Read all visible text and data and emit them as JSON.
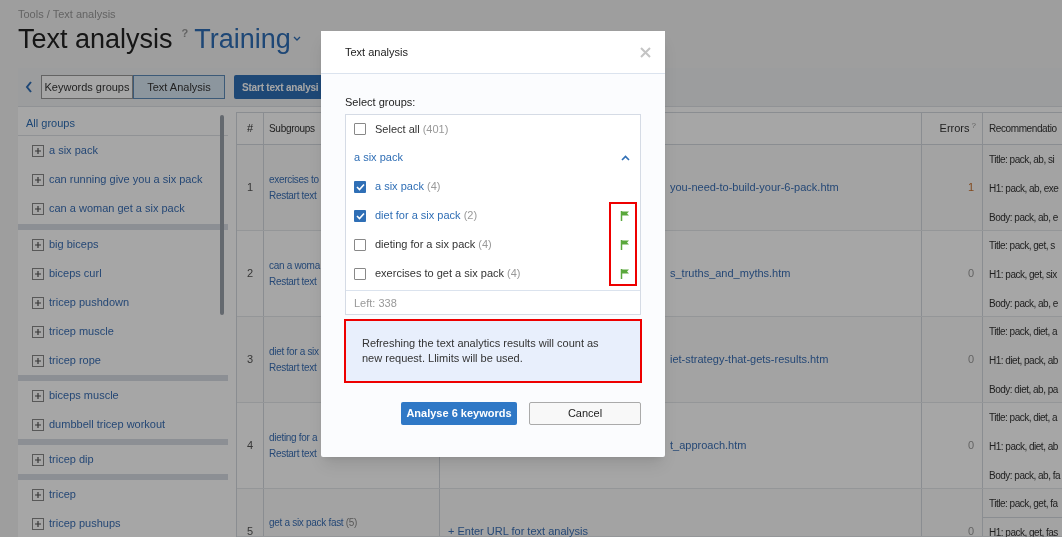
{
  "breadcrumb": "Tools / Text analysis",
  "page_title": "Text analysis",
  "title_help": "?",
  "project": "Training",
  "toolbar": {
    "tabs": [
      {
        "label": "Keywords groups",
        "selected": false
      },
      {
        "label": "Text Analysis",
        "selected": true
      }
    ],
    "start_button": "Start text analysi"
  },
  "sidebar": {
    "header": "All groups",
    "groups": [
      {
        "items": [
          "a six pack",
          "can running give you a six pack",
          "can a woman get a six pack"
        ]
      },
      {
        "items": [
          "big biceps",
          "biceps curl",
          "tricep pushdown",
          "tricep muscle",
          "tricep rope"
        ]
      },
      {
        "items": [
          "biceps muscle",
          "dumbbell tricep workout"
        ]
      },
      {
        "items": [
          "tricep dip"
        ]
      },
      {
        "items": [
          "tricep",
          "tricep pushups"
        ]
      }
    ]
  },
  "table": {
    "header": {
      "number": "#",
      "subgroups": "Subgroups",
      "errors": "Errors",
      "errors_help": "?",
      "recommendations": "Recommendatio"
    },
    "rows": [
      {
        "number": "1",
        "subgroup": "exercises to",
        "action": "Restart text",
        "url": "you-need-to-build-your-6-pack.htm",
        "errors": "1",
        "has_errors": true,
        "recommendations": [
          "Title: pack, ab, si",
          "H1: pack, ab, exe",
          "Body: pack, ab, e"
        ]
      },
      {
        "number": "2",
        "subgroup": "can a woma",
        "action": "Restart text",
        "url": "s_truths_and_myths.htm",
        "errors": "0",
        "has_errors": false,
        "recommendations": [
          "Title: pack, get, s",
          "H1: pack, get, six",
          "Body: pack, ab, e"
        ]
      },
      {
        "number": "3",
        "subgroup": "diet for a six",
        "action": "Restart text",
        "url": "iet-strategy-that-gets-results.htm",
        "errors": "0",
        "has_errors": false,
        "recommendations": [
          "Title: pack, diet, a",
          "H1: diet, pack, ab",
          "Body: diet, ab, pa"
        ]
      },
      {
        "number": "4",
        "subgroup": "dieting for a",
        "action": "Restart text",
        "url": "t_approach.htm",
        "errors": "0",
        "has_errors": false,
        "recommendations": [
          "Title: pack, diet, a",
          "H1: pack, diet, ab",
          "Body: pack, ab, fa"
        ]
      },
      {
        "number": "5",
        "subgroup": "get a six pack fast",
        "count": "(5)",
        "add_url": "+ Enter URL for text analysis",
        "errors": "0",
        "has_errors": false,
        "recommendations": [
          "Title: pack, get, fa",
          "H1: pack, get, fas"
        ]
      }
    ]
  },
  "modal": {
    "title": "Text analysis",
    "prompt": "Select groups:",
    "select_all": {
      "label": "Select all",
      "count": "(401)",
      "checked": false
    },
    "group": {
      "label": "a six pack",
      "expanded": true
    },
    "items": [
      {
        "label": "a six pack",
        "count": "(4)",
        "checked": true,
        "flag": false
      },
      {
        "label": "diet for a six pack",
        "count": "(2)",
        "checked": true,
        "flag": true
      },
      {
        "label": "dieting for a six pack",
        "count": "(4)",
        "checked": false,
        "flag": true
      },
      {
        "label": "exercises to get a six pack",
        "count": "(4)",
        "checked": false,
        "flag": true
      }
    ],
    "left": "Left: 338",
    "notice": "Refreshing the text analytics results will count as new request. Llimits will be used.",
    "highlight_flags": true,
    "highlight_notice": true,
    "buttons": [
      {
        "label": "Analyse 6 keywords",
        "kind": "primary"
      },
      {
        "label": "Cancel",
        "kind": "secondary"
      }
    ]
  }
}
